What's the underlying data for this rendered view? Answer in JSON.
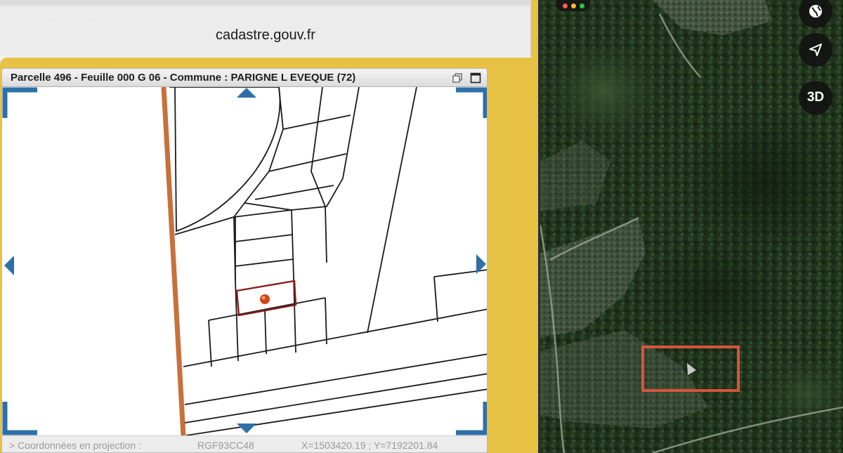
{
  "browser": {
    "watermark": "© EtreProprio.com",
    "url": "cadastre.gouv.fr"
  },
  "cadastre": {
    "title": "Parcelle 496 - Feuille 000 G 06 - Commune : PARIGNE L EVEQUE (72)",
    "restore_icon": "restore-window-icon",
    "maximize_icon": "maximize-window-icon",
    "pan_icons": [
      "pan-up-arrow-icon",
      "pan-down-arrow-icon",
      "pan-left-arrow-icon",
      "pan-right-arrow-icon"
    ],
    "status": {
      "label": "> Coordonnées en projection :",
      "projection": "RGF93CC48",
      "coords": "X=1503420.19 ; Y=7192201.84"
    },
    "colors": {
      "parcel_highlight": "#8b1a1a",
      "road": "#c8703c",
      "nav_arrow": "#2e6fa8",
      "page_background": "#e8c244"
    }
  },
  "satellite": {
    "buttons": {
      "globe_icon": "globe-icon",
      "locate_icon": "location-arrow-icon",
      "three_d": "3D"
    },
    "window_dots": [
      "#ff5f57",
      "#febc2e",
      "#28c840"
    ],
    "highlight_color": "#d9533d"
  }
}
